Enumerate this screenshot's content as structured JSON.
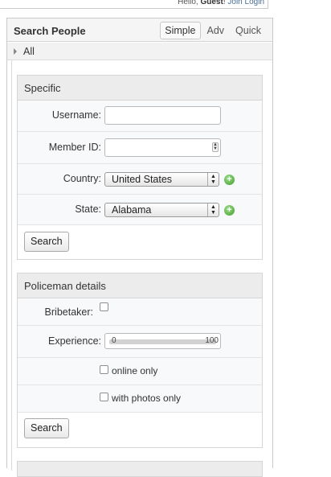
{
  "header": {
    "greeting": "Hello,",
    "guest": "Guest",
    "punct": "!",
    "join": "Join",
    "login": "Login"
  },
  "panel": {
    "title": "Search People",
    "tabs": [
      {
        "label": "Simple",
        "active": true
      },
      {
        "label": "Adv",
        "active": false
      },
      {
        "label": "Quick",
        "active": false
      }
    ],
    "all_label": "All"
  },
  "specific": {
    "title": "Specific",
    "username_label": "Username:",
    "username_value": "",
    "member_id_label": "Member ID:",
    "member_id_value": "",
    "country_label": "Country:",
    "country_value": "United States",
    "state_label": "State:",
    "state_value": "Alabama",
    "search_button": "Search"
  },
  "policeman": {
    "title": "Policeman details",
    "bribetaker_label": "Bribetaker:",
    "bribetaker_checked": false,
    "experience_label": "Experience:",
    "experience_min": "0",
    "experience_max": "100",
    "online_only_label": "online only",
    "online_only_checked": false,
    "with_photos_label": "with photos only",
    "with_photos_checked": false,
    "search_button": "Search"
  },
  "colors": {
    "accent_green": "#3f9a2c",
    "link": "#4a6f95"
  }
}
